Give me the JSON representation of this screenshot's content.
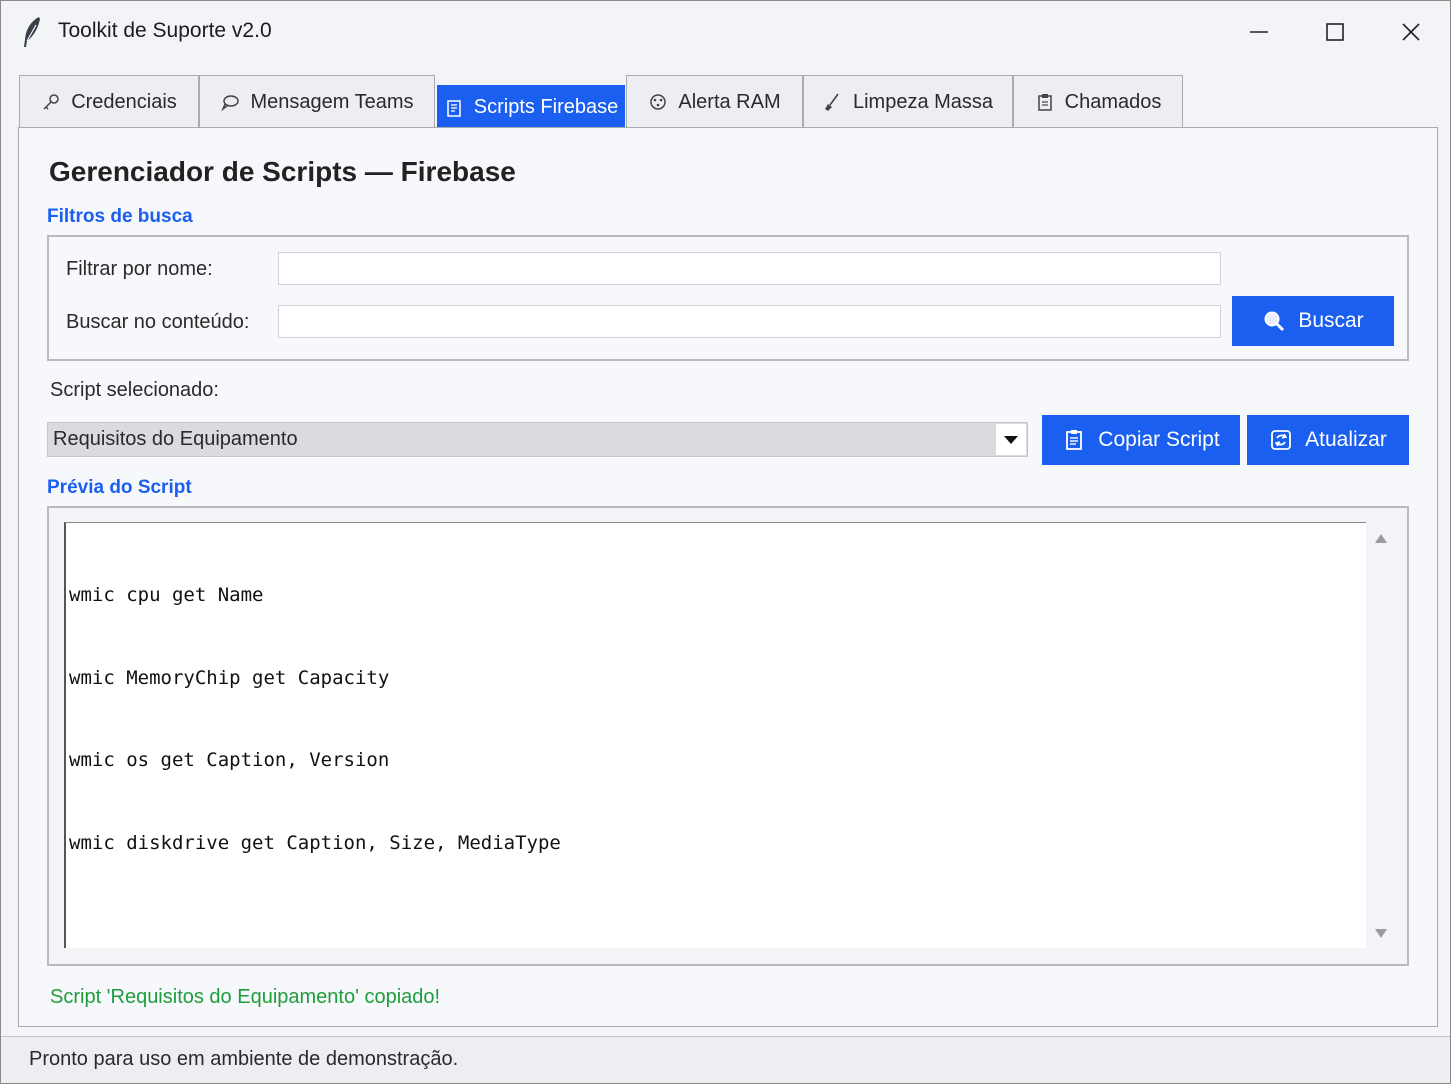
{
  "window": {
    "title": "Toolkit de Suporte v2.0",
    "controls": [
      "minimize",
      "maximize",
      "close"
    ]
  },
  "tabs": [
    {
      "label": "Credenciais",
      "icon": "key-icon",
      "active": false
    },
    {
      "label": "Mensagem Teams",
      "icon": "chat-bubble-icon",
      "active": false
    },
    {
      "label": "Scripts Firebase",
      "icon": "script-icon",
      "active": true
    },
    {
      "label": "Alerta RAM",
      "icon": "memory-icon",
      "active": false
    },
    {
      "label": "Limpeza Massa",
      "icon": "broom-icon",
      "active": false
    },
    {
      "label": "Chamados",
      "icon": "clipboard-icon",
      "active": false
    }
  ],
  "main": {
    "title": "Gerenciador de Scripts — Firebase",
    "filters": {
      "section_label": "Filtros de busca",
      "name_label": "Filtrar por nome:",
      "name_value": "",
      "content_label": "Buscar no conteúdo:",
      "content_value": "",
      "search_button": "Buscar"
    },
    "selected_script_label": "Script selecionado:",
    "selected_script": "Requisitos do Equipamento",
    "copy_button": "Copiar Script",
    "refresh_button": "Atualizar",
    "preview_label": "Prévia do Script",
    "preview_lines": [
      "wmic cpu get Name",
      "wmic MemoryChip get Capacity",
      "wmic os get Caption, Version",
      "wmic diskdrive get Caption, Size, MediaType"
    ],
    "status_message": "Script 'Requisitos do Equipamento' copiado!"
  },
  "statusbar": {
    "text": "Pronto para uso em ambiente de demonstração."
  },
  "colors": {
    "accent": "#1a5ff0",
    "success": "#1e9e3a",
    "window_bg": "#f3f4f8"
  }
}
